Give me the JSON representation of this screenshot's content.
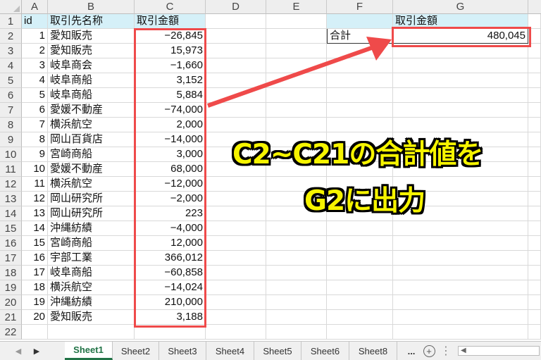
{
  "columns": {
    "A": "A",
    "B": "B",
    "C": "C",
    "D": "D",
    "E": "E",
    "F": "F",
    "G": "G"
  },
  "headers": {
    "a1": "id",
    "b1": "取引先名称",
    "c1": "取引金額",
    "g1": "取引金額"
  },
  "summary": {
    "f2_label": "合計",
    "g2_value": "480,045"
  },
  "rows": [
    {
      "n": "1",
      "id": "1",
      "name": "愛知販売",
      "amount": "−26,845"
    },
    {
      "n": "2",
      "id": "2",
      "name": "愛知販売",
      "amount": "15,973"
    },
    {
      "n": "3",
      "id": "3",
      "name": "岐阜商会",
      "amount": "−1,660"
    },
    {
      "n": "4",
      "id": "4",
      "name": "岐阜商船",
      "amount": "3,152"
    },
    {
      "n": "5",
      "id": "5",
      "name": "岐阜商船",
      "amount": "5,884"
    },
    {
      "n": "6",
      "id": "6",
      "name": "愛媛不動産",
      "amount": "−74,000"
    },
    {
      "n": "7",
      "id": "7",
      "name": "横浜航空",
      "amount": "2,000"
    },
    {
      "n": "8",
      "id": "8",
      "name": "岡山百貨店",
      "amount": "−14,000"
    },
    {
      "n": "9",
      "id": "9",
      "name": "宮崎商船",
      "amount": "3,000"
    },
    {
      "n": "10",
      "id": "10",
      "name": "愛媛不動産",
      "amount": "68,000"
    },
    {
      "n": "11",
      "id": "11",
      "name": "横浜航空",
      "amount": "−12,000"
    },
    {
      "n": "12",
      "id": "12",
      "name": "岡山研究所",
      "amount": "−2,000"
    },
    {
      "n": "13",
      "id": "13",
      "name": "岡山研究所",
      "amount": "223"
    },
    {
      "n": "14",
      "id": "14",
      "name": "沖縄紡績",
      "amount": "−4,000"
    },
    {
      "n": "15",
      "id": "15",
      "name": "宮崎商船",
      "amount": "12,000"
    },
    {
      "n": "16",
      "id": "16",
      "name": "宇部工業",
      "amount": "366,012"
    },
    {
      "n": "17",
      "id": "17",
      "name": "岐阜商船",
      "amount": "−60,858"
    },
    {
      "n": "18",
      "id": "18",
      "name": "横浜航空",
      "amount": "−14,024"
    },
    {
      "n": "19",
      "id": "19",
      "name": "沖縄紡績",
      "amount": "210,000"
    },
    {
      "n": "20",
      "id": "20",
      "name": "愛知販売",
      "amount": "3,188"
    }
  ],
  "row_numbers": [
    "1",
    "2",
    "3",
    "4",
    "5",
    "6",
    "7",
    "8",
    "9",
    "10",
    "11",
    "12",
    "13",
    "14",
    "15",
    "16",
    "17",
    "18",
    "19",
    "20",
    "21",
    "22"
  ],
  "callout": {
    "line1": "C2~C21の合計値を",
    "line2": "G2に出力"
  },
  "tabs": [
    "Sheet1",
    "Sheet2",
    "Sheet3",
    "Sheet4",
    "Sheet5",
    "Sheet6",
    "Sheet8"
  ],
  "tab_more": "...",
  "tab_add": "+",
  "colors": {
    "accent": "#217346",
    "highlight": "#ef4a4a",
    "header_fill": "#d5f0f8",
    "callout_text": "#f6f400"
  }
}
